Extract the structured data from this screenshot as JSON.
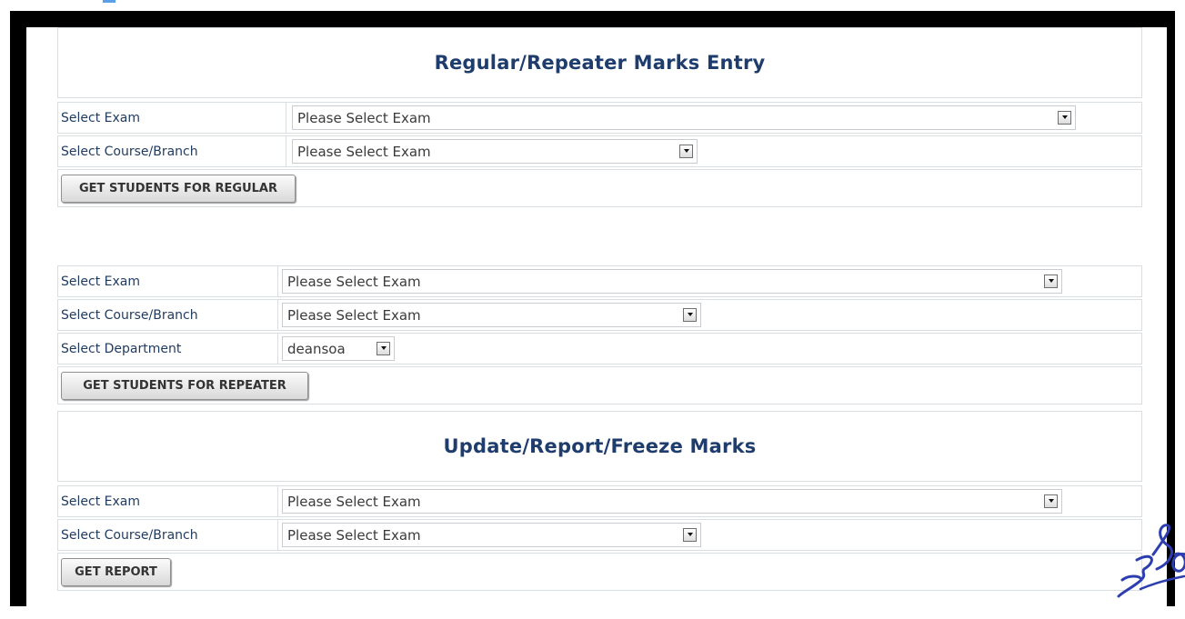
{
  "regular_section": {
    "title": "Regular/Repeater Marks Entry",
    "exam_label": "Select Exam",
    "exam_value": "Please Select Exam",
    "course_label": "Select Course/Branch",
    "course_value": "Please Select Exam",
    "button_label": "GET STUDENTS FOR REGULAR"
  },
  "repeater_section": {
    "exam_label": "Select Exam",
    "exam_value": "Please Select Exam",
    "course_label": "Select Course/Branch",
    "course_value": "Please Select Exam",
    "department_label": "Select Department",
    "department_value": "deansoa",
    "button_label": "GET STUDENTS FOR REPEATER"
  },
  "report_section": {
    "title": "Update/Report/Freeze Marks",
    "exam_label": "Select Exam",
    "exam_value": "Please Select Exam",
    "course_label": "Select Course/Branch",
    "course_value": "Please Select Exam",
    "button_label": "GET REPORT"
  },
  "colors": {
    "heading": "#1e3c6c",
    "label_text": "#1f3a5f",
    "border": "#d9dee3",
    "frame": "#000000",
    "scribble": "#2d3fb0"
  }
}
